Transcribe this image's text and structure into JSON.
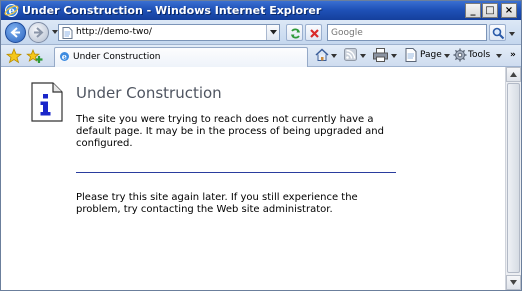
{
  "window": {
    "title": "Under Construction - Windows Internet Explorer",
    "controls": {
      "minimize": "_",
      "maximize": "□",
      "close": "×"
    }
  },
  "address_bar": {
    "url": "http://demo-two/",
    "search_placeholder": "Google"
  },
  "tab": {
    "label": "Under Construction"
  },
  "command_bar": {
    "page_label": "Page",
    "tools_label": "Tools",
    "more_label": "»"
  },
  "content": {
    "heading": "Under Construction",
    "paragraph1": "The site you were trying to reach does not currently have a default page. It may be in the process of being upgraded and configured.",
    "paragraph2": "Please try this site again later. If you still experience the problem, try contacting the Web site administrator."
  },
  "colors": {
    "title_bar": "#1f52b8",
    "heading_text": "#4f5561",
    "rule": "#2a3d9e",
    "info_icon": "#1a26c9"
  },
  "icons": [
    "ie-icon",
    "back-arrow-icon",
    "forward-arrow-icon",
    "refresh-icon",
    "stop-icon",
    "search-icon",
    "favorites-star-icon",
    "add-favorites-icon",
    "home-icon",
    "feeds-icon",
    "print-icon",
    "page-icon",
    "tools-gear-icon",
    "info-document-icon"
  ]
}
